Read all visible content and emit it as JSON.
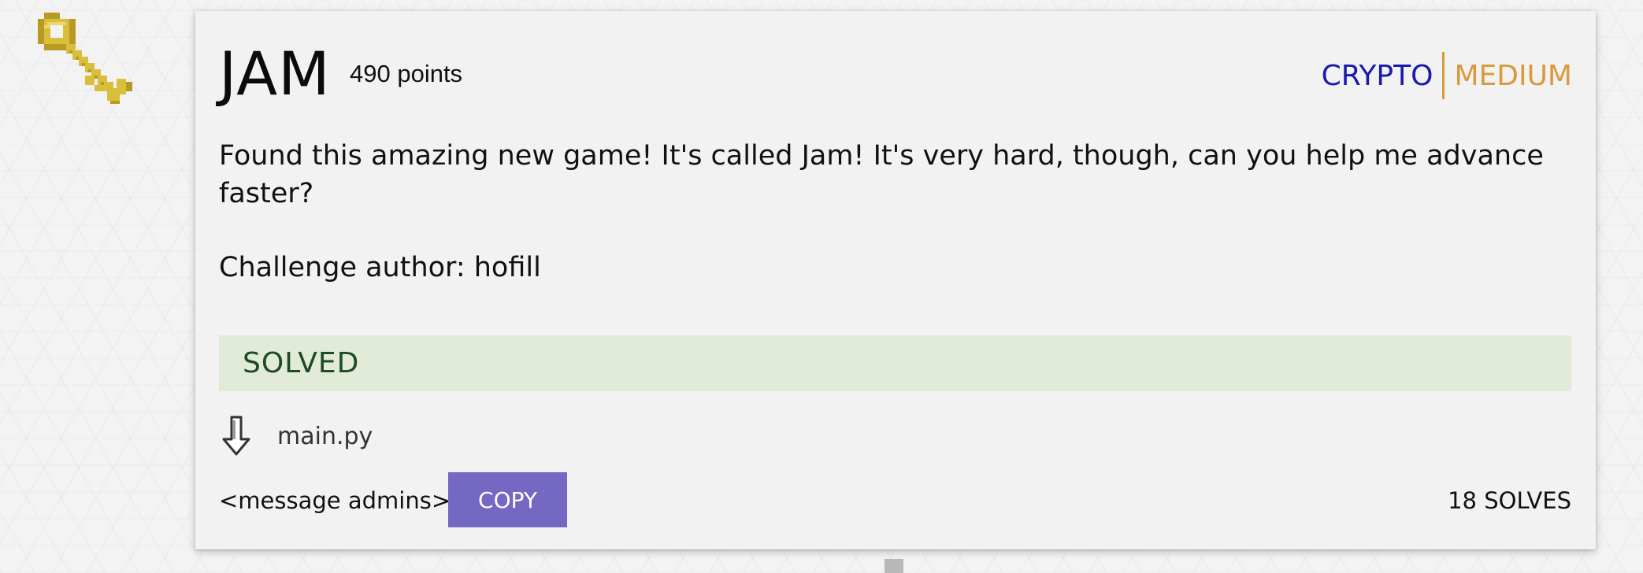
{
  "challenge": {
    "title": "JAM",
    "points": "490 points",
    "category": "CRYPTO",
    "difficulty": "MEDIUM",
    "description": "Found this amazing new game! It's called Jam! It's very hard, though, can you help me advance faster?",
    "author": "Challenge author: hofill",
    "status": "SOLVED",
    "file": "main.py",
    "admins_link": "<message admins>",
    "copy_label": "COPY",
    "solves": "18 SOLVES"
  },
  "colors": {
    "category": "#1a1ab0",
    "difficulty": "#d99a3a",
    "solved_bg": "#e1ebd7",
    "solved_text": "#1e4a24",
    "copy_button": "#7468c2",
    "key_gold": "#d8be3a"
  },
  "icons": {
    "challenge_icon": "golden-key-icon",
    "file_icon": "download-arrow-icon"
  }
}
